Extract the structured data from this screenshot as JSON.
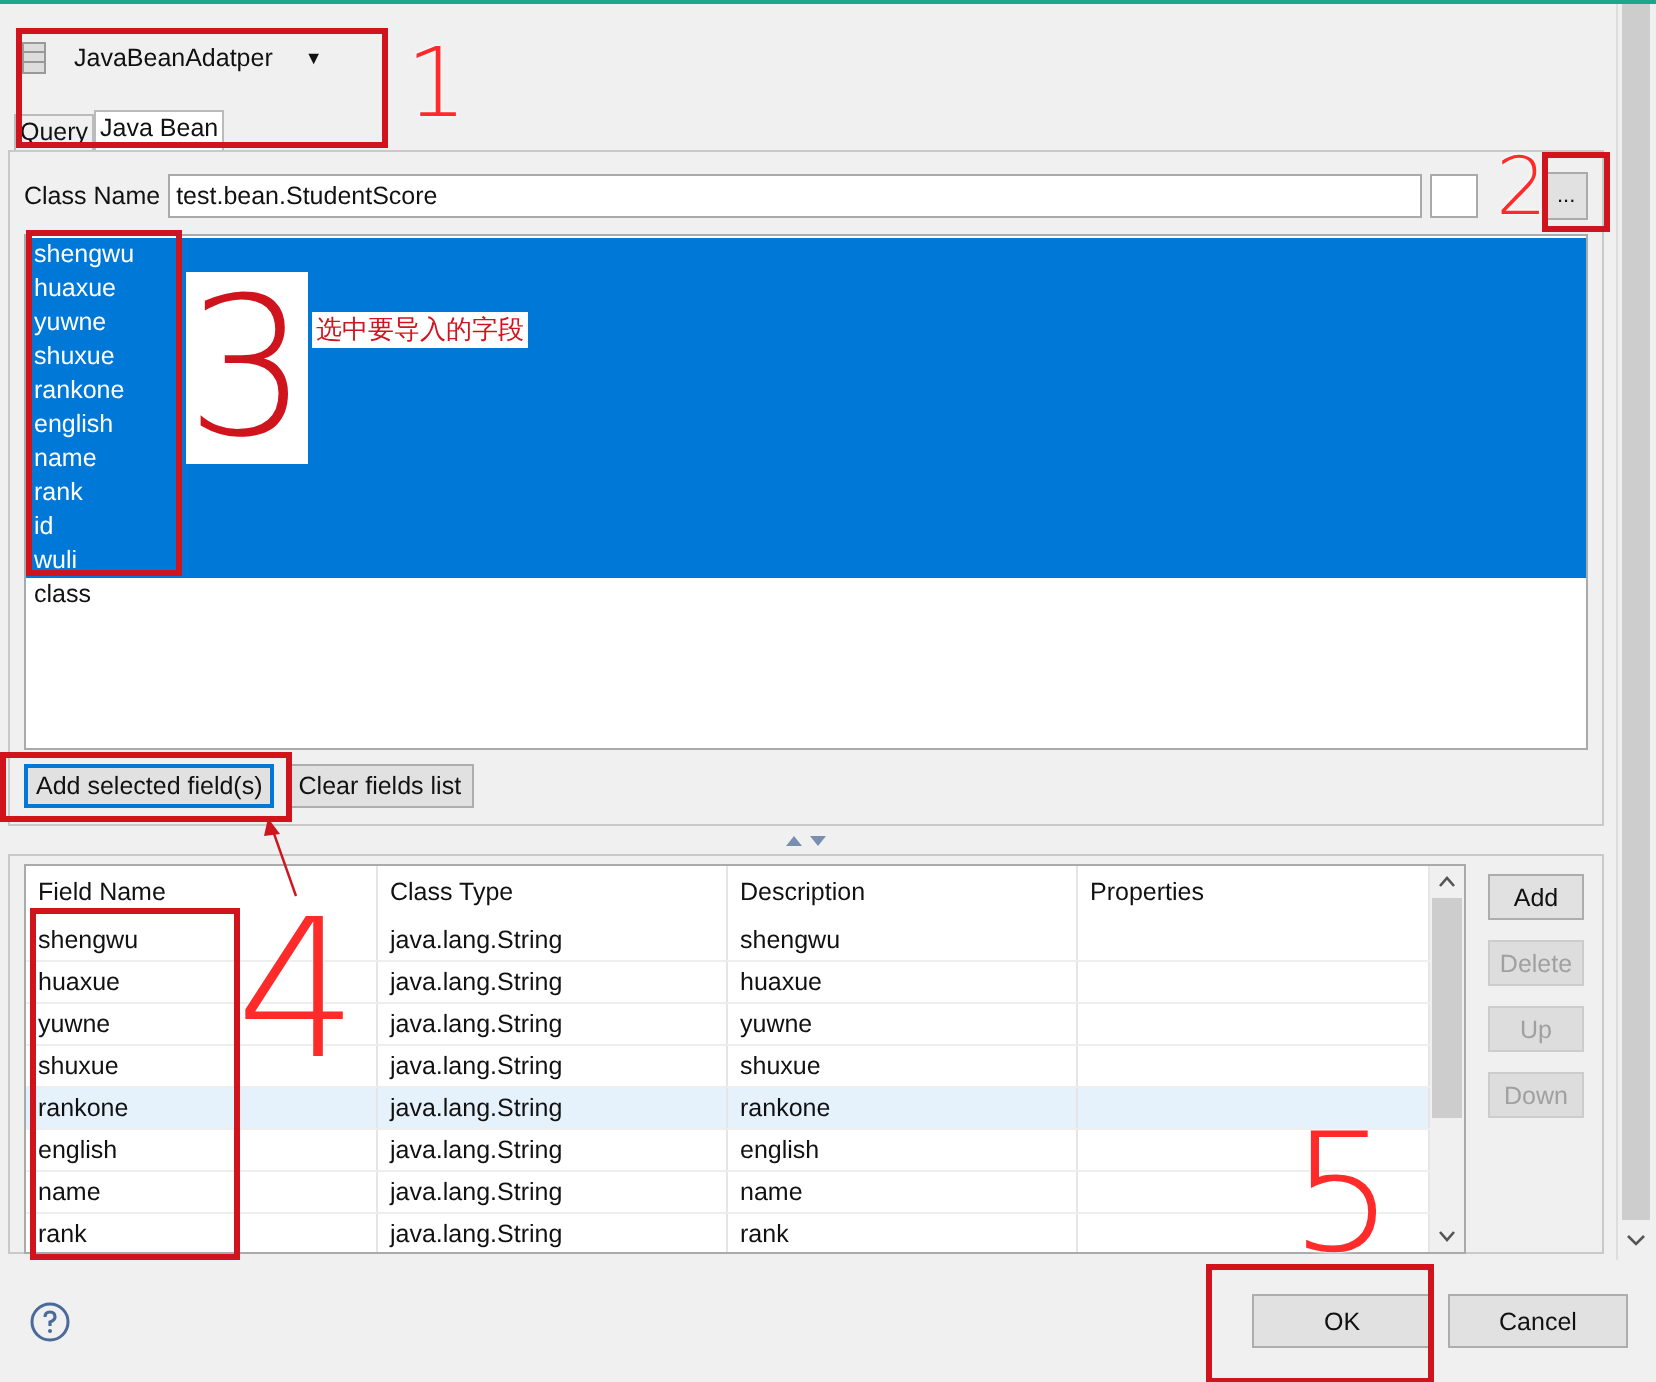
{
  "header": {
    "title": "JavaBeanAdatper",
    "caret": "▼"
  },
  "tabs": [
    {
      "label": "Query",
      "selected": false
    },
    {
      "label": "Java Bean",
      "selected": true
    }
  ],
  "class_name": {
    "label": "Class Name",
    "value": "test.bean.StudentScore",
    "browse": "..."
  },
  "fields": [
    {
      "name": "shengwu",
      "selected": true
    },
    {
      "name": "huaxue",
      "selected": true
    },
    {
      "name": "yuwne",
      "selected": true
    },
    {
      "name": "shuxue",
      "selected": true
    },
    {
      "name": "rankone",
      "selected": true
    },
    {
      "name": "english",
      "selected": true
    },
    {
      "name": "name",
      "selected": true
    },
    {
      "name": "rank",
      "selected": true
    },
    {
      "name": "id",
      "selected": true
    },
    {
      "name": "wuli",
      "selected": true
    },
    {
      "name": "class",
      "selected": false
    }
  ],
  "field_buttons": [
    {
      "label": "Add selected field(s)",
      "focused": true
    },
    {
      "label": "Clear fields list",
      "focused": false
    }
  ],
  "table": {
    "columns": [
      "Field Name",
      "Class Type",
      "Description",
      "Properties"
    ],
    "rows": [
      {
        "cells": [
          "shengwu",
          "java.lang.String",
          "shengwu",
          ""
        ],
        "selected": false
      },
      {
        "cells": [
          "huaxue",
          "java.lang.String",
          "huaxue",
          ""
        ],
        "selected": false
      },
      {
        "cells": [
          "yuwne",
          "java.lang.String",
          "yuwne",
          ""
        ],
        "selected": false
      },
      {
        "cells": [
          "shuxue",
          "java.lang.String",
          "shuxue",
          ""
        ],
        "selected": false
      },
      {
        "cells": [
          "rankone",
          "java.lang.String",
          "rankone",
          ""
        ],
        "selected": true
      },
      {
        "cells": [
          "english",
          "java.lang.String",
          "english",
          ""
        ],
        "selected": false
      },
      {
        "cells": [
          "name",
          "java.lang.String",
          "name",
          ""
        ],
        "selected": false
      },
      {
        "cells": [
          "rank",
          "java.lang.String",
          "rank",
          ""
        ],
        "selected": false
      }
    ]
  },
  "side_buttons": [
    {
      "label": "Add",
      "disabled": false
    },
    {
      "label": "Delete",
      "disabled": true
    },
    {
      "label": "Up",
      "disabled": true
    },
    {
      "label": "Down",
      "disabled": true
    }
  ],
  "footer_buttons": [
    "OK",
    "Cancel"
  ],
  "annotations": {
    "numbers": [
      "1",
      "2",
      "3",
      "4",
      "5"
    ],
    "note": "选中要导入的字段"
  }
}
